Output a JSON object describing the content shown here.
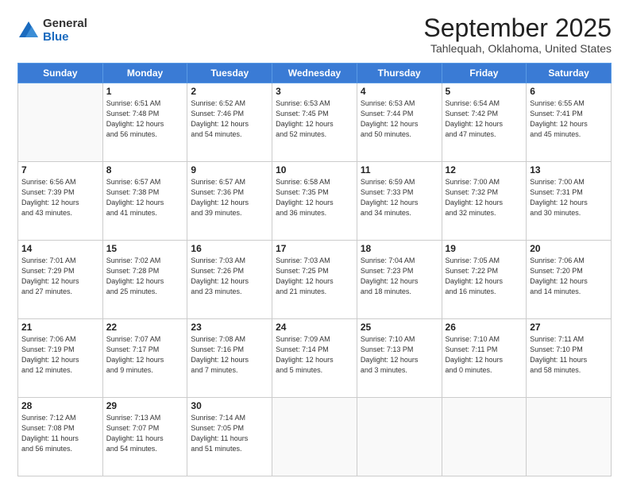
{
  "header": {
    "logo": {
      "general": "General",
      "blue": "Blue"
    },
    "title": "September 2025",
    "location": "Tahlequah, Oklahoma, United States"
  },
  "calendar": {
    "days_of_week": [
      "Sunday",
      "Monday",
      "Tuesday",
      "Wednesday",
      "Thursday",
      "Friday",
      "Saturday"
    ],
    "weeks": [
      [
        {
          "day": "",
          "info": ""
        },
        {
          "day": "1",
          "info": "Sunrise: 6:51 AM\nSunset: 7:48 PM\nDaylight: 12 hours\nand 56 minutes."
        },
        {
          "day": "2",
          "info": "Sunrise: 6:52 AM\nSunset: 7:46 PM\nDaylight: 12 hours\nand 54 minutes."
        },
        {
          "day": "3",
          "info": "Sunrise: 6:53 AM\nSunset: 7:45 PM\nDaylight: 12 hours\nand 52 minutes."
        },
        {
          "day": "4",
          "info": "Sunrise: 6:53 AM\nSunset: 7:44 PM\nDaylight: 12 hours\nand 50 minutes."
        },
        {
          "day": "5",
          "info": "Sunrise: 6:54 AM\nSunset: 7:42 PM\nDaylight: 12 hours\nand 47 minutes."
        },
        {
          "day": "6",
          "info": "Sunrise: 6:55 AM\nSunset: 7:41 PM\nDaylight: 12 hours\nand 45 minutes."
        }
      ],
      [
        {
          "day": "7",
          "info": "Sunrise: 6:56 AM\nSunset: 7:39 PM\nDaylight: 12 hours\nand 43 minutes."
        },
        {
          "day": "8",
          "info": "Sunrise: 6:57 AM\nSunset: 7:38 PM\nDaylight: 12 hours\nand 41 minutes."
        },
        {
          "day": "9",
          "info": "Sunrise: 6:57 AM\nSunset: 7:36 PM\nDaylight: 12 hours\nand 39 minutes."
        },
        {
          "day": "10",
          "info": "Sunrise: 6:58 AM\nSunset: 7:35 PM\nDaylight: 12 hours\nand 36 minutes."
        },
        {
          "day": "11",
          "info": "Sunrise: 6:59 AM\nSunset: 7:33 PM\nDaylight: 12 hours\nand 34 minutes."
        },
        {
          "day": "12",
          "info": "Sunrise: 7:00 AM\nSunset: 7:32 PM\nDaylight: 12 hours\nand 32 minutes."
        },
        {
          "day": "13",
          "info": "Sunrise: 7:00 AM\nSunset: 7:31 PM\nDaylight: 12 hours\nand 30 minutes."
        }
      ],
      [
        {
          "day": "14",
          "info": "Sunrise: 7:01 AM\nSunset: 7:29 PM\nDaylight: 12 hours\nand 27 minutes."
        },
        {
          "day": "15",
          "info": "Sunrise: 7:02 AM\nSunset: 7:28 PM\nDaylight: 12 hours\nand 25 minutes."
        },
        {
          "day": "16",
          "info": "Sunrise: 7:03 AM\nSunset: 7:26 PM\nDaylight: 12 hours\nand 23 minutes."
        },
        {
          "day": "17",
          "info": "Sunrise: 7:03 AM\nSunset: 7:25 PM\nDaylight: 12 hours\nand 21 minutes."
        },
        {
          "day": "18",
          "info": "Sunrise: 7:04 AM\nSunset: 7:23 PM\nDaylight: 12 hours\nand 18 minutes."
        },
        {
          "day": "19",
          "info": "Sunrise: 7:05 AM\nSunset: 7:22 PM\nDaylight: 12 hours\nand 16 minutes."
        },
        {
          "day": "20",
          "info": "Sunrise: 7:06 AM\nSunset: 7:20 PM\nDaylight: 12 hours\nand 14 minutes."
        }
      ],
      [
        {
          "day": "21",
          "info": "Sunrise: 7:06 AM\nSunset: 7:19 PM\nDaylight: 12 hours\nand 12 minutes."
        },
        {
          "day": "22",
          "info": "Sunrise: 7:07 AM\nSunset: 7:17 PM\nDaylight: 12 hours\nand 9 minutes."
        },
        {
          "day": "23",
          "info": "Sunrise: 7:08 AM\nSunset: 7:16 PM\nDaylight: 12 hours\nand 7 minutes."
        },
        {
          "day": "24",
          "info": "Sunrise: 7:09 AM\nSunset: 7:14 PM\nDaylight: 12 hours\nand 5 minutes."
        },
        {
          "day": "25",
          "info": "Sunrise: 7:10 AM\nSunset: 7:13 PM\nDaylight: 12 hours\nand 3 minutes."
        },
        {
          "day": "26",
          "info": "Sunrise: 7:10 AM\nSunset: 7:11 PM\nDaylight: 12 hours\nand 0 minutes."
        },
        {
          "day": "27",
          "info": "Sunrise: 7:11 AM\nSunset: 7:10 PM\nDaylight: 11 hours\nand 58 minutes."
        }
      ],
      [
        {
          "day": "28",
          "info": "Sunrise: 7:12 AM\nSunset: 7:08 PM\nDaylight: 11 hours\nand 56 minutes."
        },
        {
          "day": "29",
          "info": "Sunrise: 7:13 AM\nSunset: 7:07 PM\nDaylight: 11 hours\nand 54 minutes."
        },
        {
          "day": "30",
          "info": "Sunrise: 7:14 AM\nSunset: 7:05 PM\nDaylight: 11 hours\nand 51 minutes."
        },
        {
          "day": "",
          "info": ""
        },
        {
          "day": "",
          "info": ""
        },
        {
          "day": "",
          "info": ""
        },
        {
          "day": "",
          "info": ""
        }
      ]
    ]
  }
}
